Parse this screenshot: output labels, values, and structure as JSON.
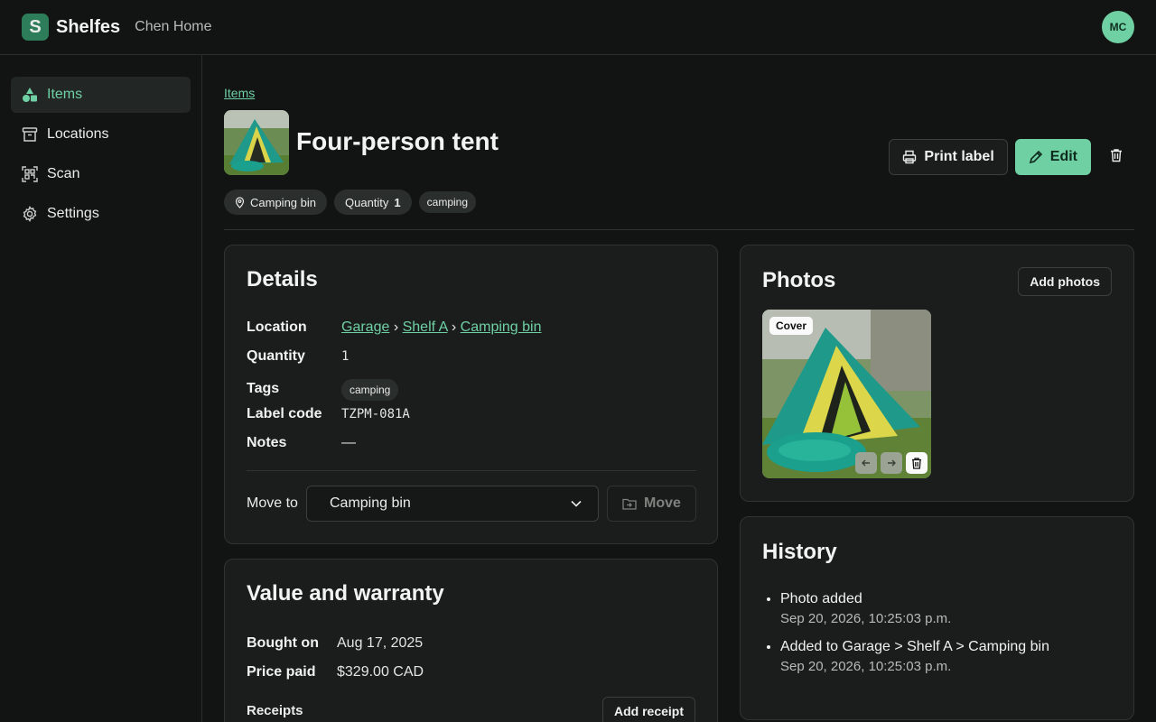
{
  "header": {
    "brand": "Shelfes",
    "household": "Chen Home",
    "avatar_initials": "MC"
  },
  "sidebar": {
    "items": [
      {
        "label": "Items",
        "icon": "shapes-icon",
        "active": true
      },
      {
        "label": "Locations",
        "icon": "archive-box-icon"
      },
      {
        "label": "Scan",
        "icon": "qr-scan-icon"
      },
      {
        "label": "Settings",
        "icon": "gear-icon"
      }
    ]
  },
  "breadcrumb": "Items",
  "item": {
    "title": "Four-person tent"
  },
  "actions": {
    "print_label": "Print label",
    "edit": "Edit"
  },
  "chips": {
    "location": "Camping bin",
    "quantity_label": "Quantity",
    "quantity_value": "1",
    "tag": "camping"
  },
  "details": {
    "title": "Details",
    "location_label": "Location",
    "location_path": [
      "Garage",
      "Shelf A",
      "Camping bin"
    ],
    "separator": "›",
    "quantity_label": "Quantity",
    "quantity_value": "1",
    "tags_label": "Tags",
    "tag": "camping",
    "label_code_label": "Label code",
    "label_code_value": "TZPM-081A",
    "notes_label": "Notes",
    "notes_value": "—",
    "move_to_label": "Move to",
    "move_to_selected": "Camping bin",
    "move_button": "Move"
  },
  "value": {
    "title": "Value and warranty",
    "bought_label": "Bought on",
    "bought_value": "Aug 17, 2025",
    "price_label": "Price paid",
    "price_value": "$329.00 CAD",
    "receipts_label": "Receipts",
    "add_receipt": "Add receipt"
  },
  "photos": {
    "title": "Photos",
    "add_button": "Add photos",
    "cover_badge": "Cover"
  },
  "history": {
    "title": "History",
    "entries": [
      {
        "text": "Photo added",
        "time": "Sep 20, 2026, 10:25:03 p.m."
      },
      {
        "text": "Added to Garage > Shelf A > Camping bin",
        "time": "Sep 20, 2026, 10:25:03 p.m."
      }
    ]
  },
  "colors": {
    "accent": "#6fd0a4",
    "background": "#121413",
    "card": "#1a1d1c"
  }
}
